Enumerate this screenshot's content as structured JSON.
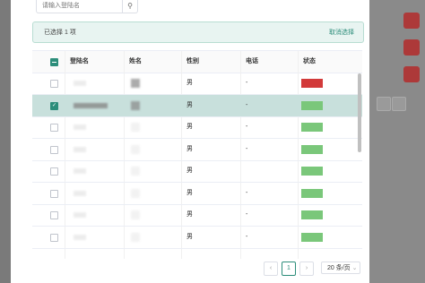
{
  "search": {
    "placeholder": "请输入登陆名",
    "icon": "search-icon"
  },
  "selection": {
    "text": "已选择 1 项",
    "cancel_label": "取消选择"
  },
  "table": {
    "columns": [
      "登陆名",
      "姓名",
      "性别",
      "电话",
      "状态"
    ],
    "rows": [
      {
        "selected": false,
        "gender": "男",
        "phone": "-",
        "status_color": "#d23a3a"
      },
      {
        "selected": true,
        "gender": "男",
        "phone": "-",
        "status_color": "#7ac77a"
      },
      {
        "selected": false,
        "gender": "男",
        "phone": "-",
        "status_color": "#7ac77a"
      },
      {
        "selected": false,
        "gender": "男",
        "phone": "-",
        "status_color": "#7ac77a"
      },
      {
        "selected": false,
        "gender": "男",
        "phone": "",
        "status_color": "#7ac77a"
      },
      {
        "selected": false,
        "gender": "男",
        "phone": "-",
        "status_color": "#7ac77a"
      },
      {
        "selected": false,
        "gender": "男",
        "phone": "-",
        "status_color": "#7ac77a"
      },
      {
        "selected": false,
        "gender": "男",
        "phone": "-",
        "status_color": "#7ac77a"
      }
    ]
  },
  "pagination": {
    "prev": "‹",
    "current": "1",
    "next": "›",
    "page_size": "20 条/页"
  },
  "colors": {
    "accent": "#2c8d7a",
    "danger": "#d23a3a",
    "success": "#7ac77a"
  }
}
